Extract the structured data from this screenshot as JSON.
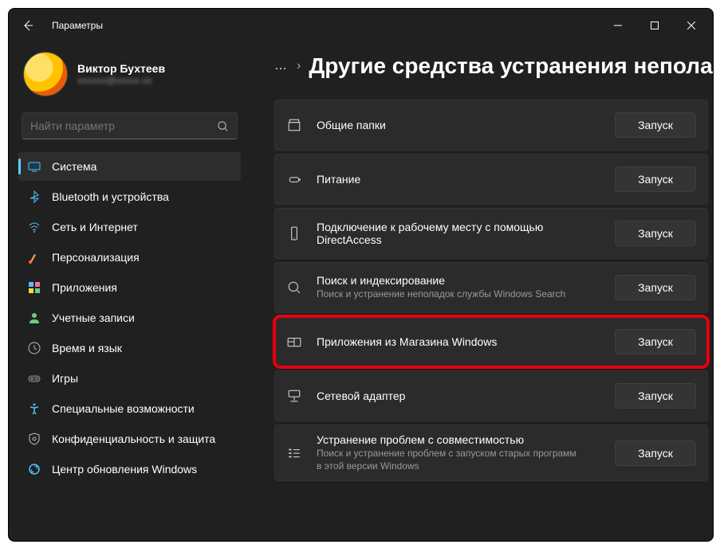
{
  "window": {
    "title": "Параметры"
  },
  "profile": {
    "name": "Виктор Бухтеев",
    "email": "xxxxxx@xxxxx.xx"
  },
  "search": {
    "placeholder": "Найти параметр"
  },
  "sidebar": {
    "items": [
      {
        "label": "Система",
        "icon": "system",
        "selected": true
      },
      {
        "label": "Bluetooth и устройства",
        "icon": "bluetooth",
        "selected": false
      },
      {
        "label": "Сеть и Интернет",
        "icon": "wifi",
        "selected": false
      },
      {
        "label": "Персонализация",
        "icon": "brush",
        "selected": false
      },
      {
        "label": "Приложения",
        "icon": "apps",
        "selected": false
      },
      {
        "label": "Учетные записи",
        "icon": "account",
        "selected": false
      },
      {
        "label": "Время и язык",
        "icon": "time",
        "selected": false
      },
      {
        "label": "Игры",
        "icon": "gaming",
        "selected": false
      },
      {
        "label": "Специальные возможности",
        "icon": "access",
        "selected": false
      },
      {
        "label": "Конфиденциальность и защита",
        "icon": "privacy",
        "selected": false
      },
      {
        "label": "Центр обновления Windows",
        "icon": "update",
        "selected": false
      }
    ]
  },
  "breadcrumb": {
    "more": "…",
    "separator": "›",
    "title": "Другие средства устранения непола"
  },
  "run_label": "Запуск",
  "troubleshooters": [
    {
      "icon": "folder",
      "title": "Общие папки",
      "sub": ""
    },
    {
      "icon": "power",
      "title": "Питание",
      "sub": ""
    },
    {
      "icon": "phone",
      "title": "Подключение к рабочему месту с помощью DirectAccess",
      "sub": ""
    },
    {
      "icon": "search",
      "title": "Поиск и индексирование",
      "sub": "Поиск и устранение неполадок службы Windows Search"
    },
    {
      "icon": "apps",
      "title": "Приложения из Магазина Windows",
      "sub": "",
      "highlighted": true
    },
    {
      "icon": "network",
      "title": "Сетевой адаптер",
      "sub": ""
    },
    {
      "icon": "compat",
      "title": "Устранение проблем с совместимостью",
      "sub": "Поиск и устранение проблем с запуском старых программ в этой версии Windows"
    }
  ]
}
